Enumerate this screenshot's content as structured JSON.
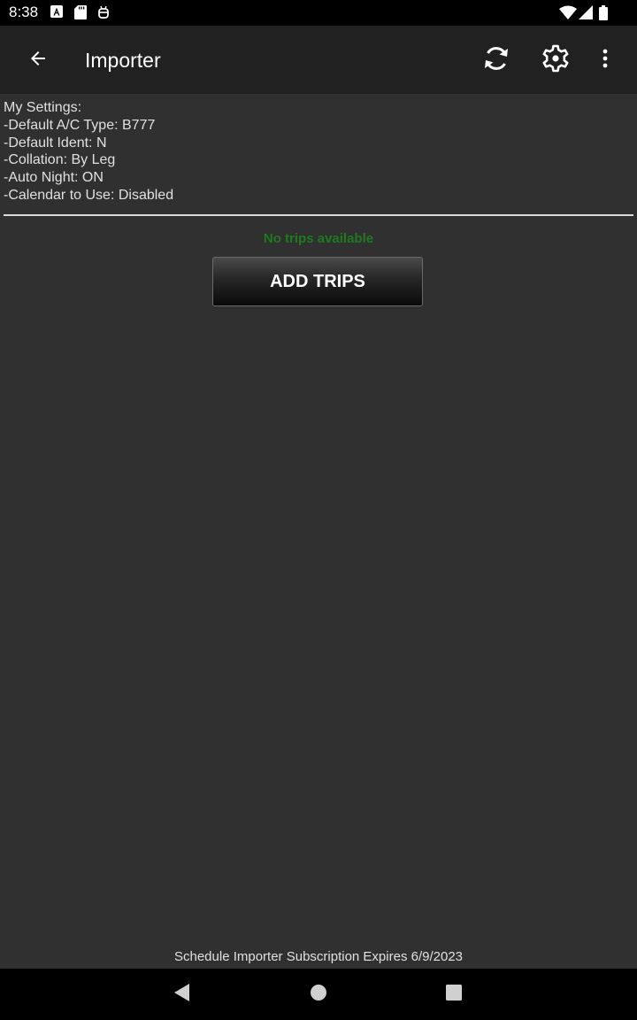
{
  "status_bar": {
    "time": "8:38",
    "icons": [
      "notification-a-icon",
      "sd-card-icon",
      "android-icon",
      "wifi-icon",
      "signal-icon",
      "battery-icon"
    ]
  },
  "app_bar": {
    "title": "Importer",
    "actions": [
      "back-arrow-icon",
      "sync-icon",
      "gear-icon",
      "overflow-menu-icon"
    ]
  },
  "settings": {
    "lines": [
      "My Settings:",
      "-Default A/C Type: B777",
      "-Default Ident: N",
      "-Collation: By Leg",
      "-Auto Night: ON",
      "-Calendar to Use: Disabled"
    ]
  },
  "trips": {
    "empty_message": "No trips available",
    "add_button_label": "ADD TRIPS"
  },
  "footer": {
    "subscription_text": "Schedule Importer Subscription Expires 6/9/2023"
  },
  "colors": {
    "background": "#303030",
    "app_bar": "#212121",
    "empty_message": "#1e7a1e"
  }
}
